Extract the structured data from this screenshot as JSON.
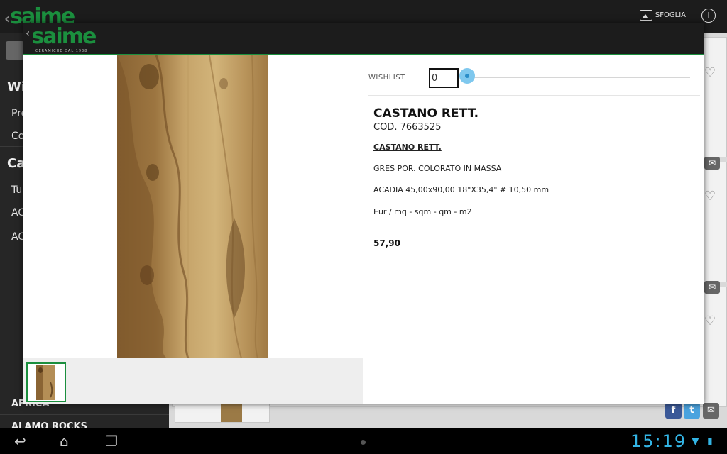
{
  "background": {
    "logo": "saime",
    "topbar": {
      "sfoglia_label": "SFOGLIA",
      "info_label": "i"
    },
    "sidebar": {
      "heading_wishlist": "Wis",
      "items_top": [
        "Pre",
        "Co"
      ],
      "heading_category": "Cat",
      "items_cat": [
        "Tu",
        "AC",
        "AC"
      ],
      "bottom_items": [
        "AFRICA",
        "ALAMO ROCKS"
      ]
    }
  },
  "modal": {
    "logo": "saime",
    "logo_sub": "CERAMICHE DAL 1938",
    "wishlist": {
      "label": "WISHLIST",
      "value": "0"
    },
    "product": {
      "title": "CASTANO RETT.",
      "code": "COD. 7663525",
      "name": "CASTANO RETT.",
      "material": "GRES POR. COLORATO IN MASSA",
      "size": "ACADIA 45,00x90,00 18\"X35,4\" # 10,50 mm",
      "unit": "Eur / mq - sqm - qm - m2",
      "price": "57,90"
    }
  },
  "statusbar": {
    "time": "15:19"
  },
  "colors": {
    "brand_green": "#1b8f3e",
    "accent_blue": "#33b5e5",
    "slider_blue": "#7fc8ee"
  }
}
